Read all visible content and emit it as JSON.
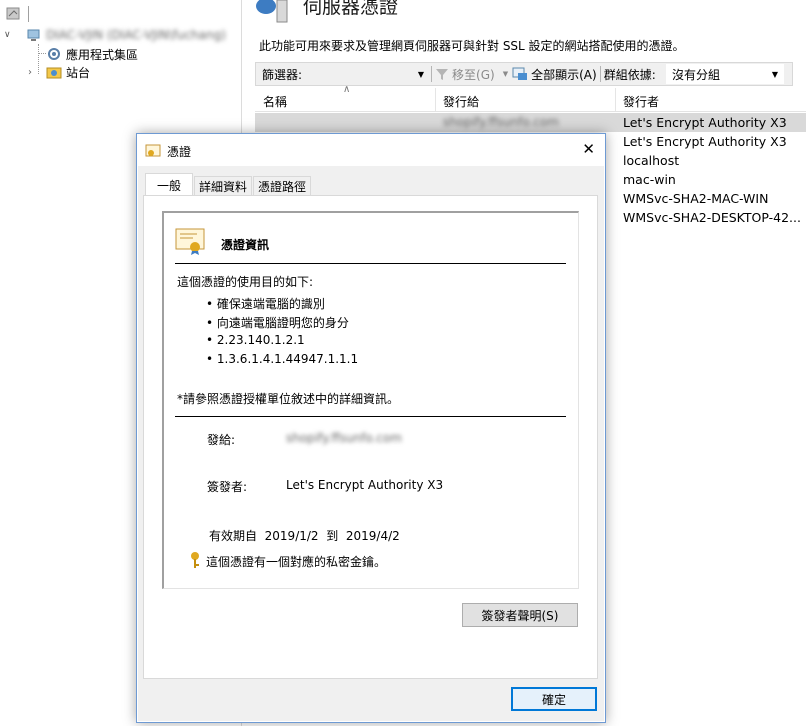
{
  "tree": {
    "server_node": "DIAC-VJIN (DIAC-VJIN\\fuchang)",
    "items": [
      {
        "label": "應用程式集區"
      },
      {
        "label": "站台"
      }
    ]
  },
  "right_pane": {
    "title": "伺服器憑證",
    "description": "此功能可用來要求及管理網頁伺服器可與針對 SSL 設定的網站搭配使用的憑證。",
    "filter": {
      "label": "篩選器:",
      "go_label": "移至(G)",
      "show_all_label": "全部顯示(A)",
      "group_by_label": "群組依據:",
      "group_by_value": "沒有分組"
    },
    "columns": {
      "name": "名稱",
      "issued_to": "發行給",
      "issuer": "發行者"
    },
    "rows": [
      {
        "issued_to": "shopify.ffsunfo.com",
        "issuer": "Let's Encrypt Authority X3"
      },
      {
        "issuer": "Let's Encrypt Authority X3"
      },
      {
        "issuer": "localhost"
      },
      {
        "issuer": "mac-win"
      },
      {
        "issuer": "WMSvc-SHA2-MAC-WIN"
      },
      {
        "issuer": "WMSvc-SHA2-DESKTOP-42..."
      }
    ]
  },
  "dialog": {
    "title": "憑證",
    "close_glyph": "✕",
    "tabs": [
      {
        "label": "一般"
      },
      {
        "label": "詳細資料"
      },
      {
        "label": "憑證路徑"
      }
    ],
    "info_header": "憑證資訊",
    "purpose_heading": "這個憑證的使用目的如下:",
    "purposes": [
      "確保遠端電腦的識別",
      "向遠端電腦證明您的身分",
      "2.23.140.1.2.1",
      "1.3.6.1.4.1.44947.1.1.1"
    ],
    "note": "*請參照憑證授權單位敘述中的詳細資訊。",
    "issued_to_label": "發給:",
    "issued_to_value": "shopify.ffsunfo.com",
    "issued_by_label": "簽發者:",
    "issued_by_value": "Let's Encrypt Authority X3",
    "validity_label": "有效期自",
    "valid_from": "2019/1/2",
    "to_label": "到",
    "valid_to": "2019/4/2",
    "private_key_note": "這個憑證有一個對應的私密金鑰。",
    "issuer_statement_button": "簽發者聲明(S)",
    "ok_button": "確定"
  },
  "colors": {
    "selection": "#d9d9d9",
    "dialog_border": "#6e9ad3",
    "default_button_border": "#0078d7",
    "key_icon": "#e0a820"
  }
}
